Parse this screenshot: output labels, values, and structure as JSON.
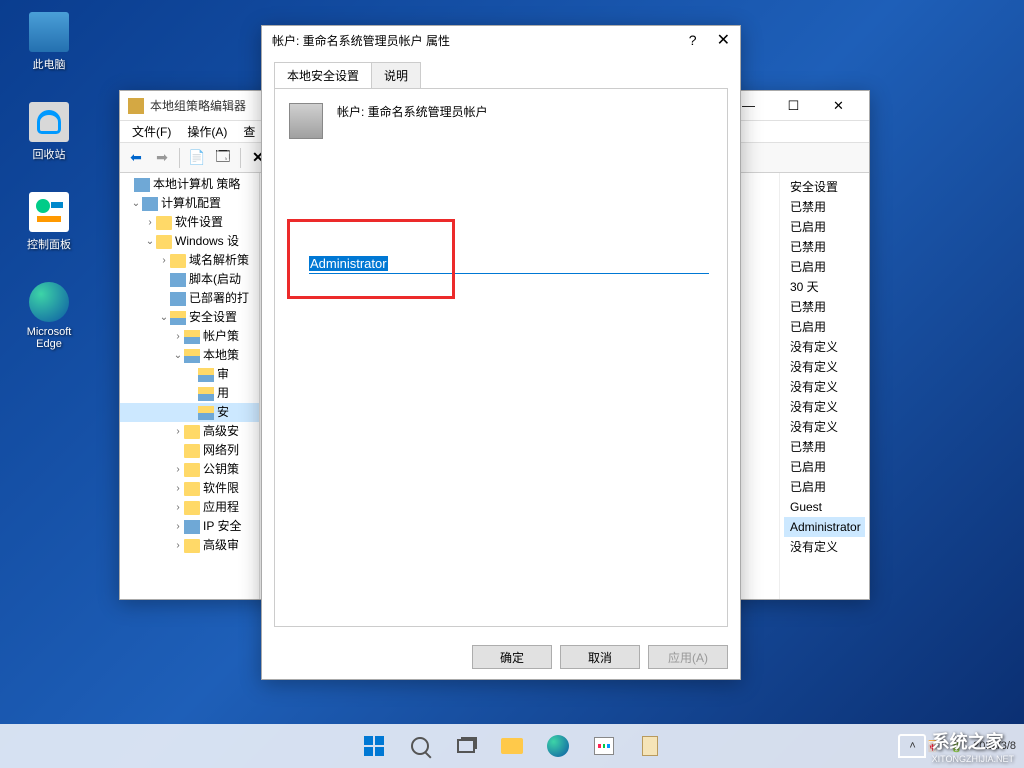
{
  "desktop": {
    "icons": [
      {
        "name": "this-pc",
        "label": "此电脑"
      },
      {
        "name": "recycle-bin",
        "label": "回收站"
      },
      {
        "name": "control-panel",
        "label": "控制面板"
      },
      {
        "name": "edge",
        "label": "Microsoft Edge"
      }
    ]
  },
  "gpedit": {
    "title": "本地组策略编辑器",
    "menu": {
      "file": "文件(F)",
      "action": "操作(A)",
      "view": "查"
    },
    "tree": {
      "root": "本地计算机 策略",
      "computer_config": "计算机配置",
      "software_settings": "软件设置",
      "windows_settings": "Windows 设",
      "dns_policy": "域名解析策",
      "scripts": "脚本(启动",
      "deployed": "已部署的打",
      "security_settings": "安全设置",
      "account_policies": "帐户策",
      "local_policies": "本地策",
      "audit": "审",
      "user_rights": "用",
      "security_options": "安",
      "advanced_security": "高级安",
      "network_list": "网络列",
      "pki": "公钥策",
      "software_restrict": "软件限",
      "app_control": "应用程",
      "ip_security": "IP 安全",
      "advanced_audit": "高级审"
    },
    "values": [
      "安全设置",
      "已禁用",
      "已启用",
      "已禁用",
      "已启用",
      "30 天",
      "已禁用",
      "已启用",
      "没有定义",
      "没有定义",
      "没有定义",
      "没有定义",
      "没有定义",
      "已禁用",
      "已启用",
      "已启用",
      "Guest",
      "Administrator",
      "没有定义"
    ],
    "selected_value_index": 17
  },
  "props": {
    "title": "帐户: 重命名系统管理员帐户 属性",
    "tabs": {
      "local": "本地安全设置",
      "desc": "说明"
    },
    "header": "帐户: 重命名系统管理员帐户",
    "input_value": "Administrator",
    "buttons": {
      "ok": "确定",
      "cancel": "取消",
      "apply": "应用(A)"
    }
  },
  "taskbar": {
    "date": "2022/3/8"
  },
  "watermark": {
    "text": "系统之家",
    "sub": "XITONGZHIJIA.NET"
  }
}
